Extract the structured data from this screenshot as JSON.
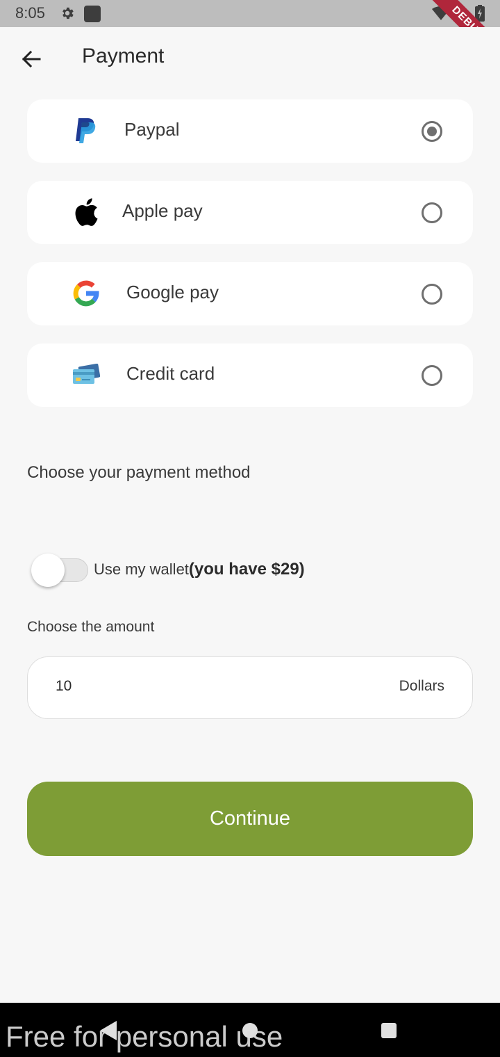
{
  "status_bar": {
    "time": "8:05",
    "debug_label": "DEBUG",
    "icons": [
      "gear-icon",
      "square-icon",
      "wifi-icon",
      "battery-icon"
    ]
  },
  "app_bar": {
    "title": "Payment",
    "back_icon": "arrow-left-icon"
  },
  "payment_methods": [
    {
      "label": "Paypal",
      "icon": "paypal-icon",
      "selected": true
    },
    {
      "label": "Apple pay",
      "icon": "apple-icon",
      "selected": false
    },
    {
      "label": "Google pay",
      "icon": "google-icon",
      "selected": false
    },
    {
      "label": "Credit card",
      "icon": "credit-card-icon",
      "selected": false
    }
  ],
  "choose_method_label": "Choose your payment method",
  "wallet": {
    "label": "Use my wallet",
    "balance_text": "(you have $29)",
    "enabled": false
  },
  "amount": {
    "label": "Choose the amount",
    "value": "10",
    "unit": "Dollars"
  },
  "continue_label": "Continue",
  "watermark": "Free for personal use",
  "colors": {
    "accent": "#7e9d36",
    "background": "#f7f7f7",
    "card": "#ffffff",
    "debug_ribbon": "#b0263b"
  }
}
